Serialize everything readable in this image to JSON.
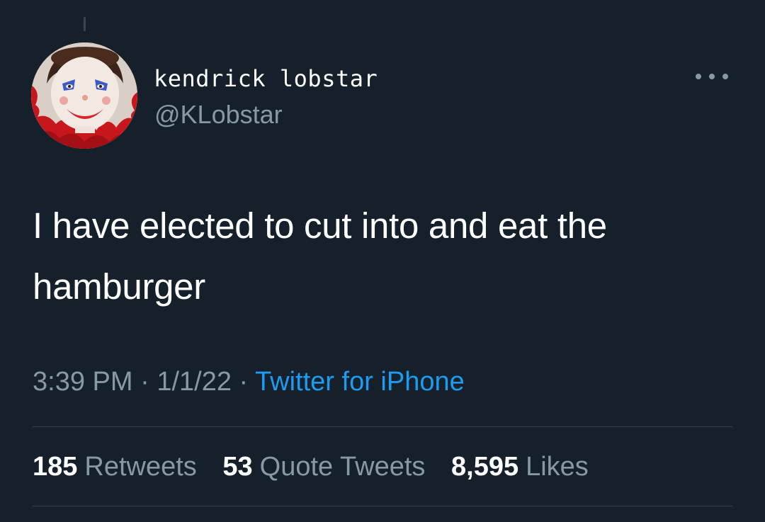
{
  "author": {
    "display_name": "kendrick lobstar",
    "handle": "@KLobstar",
    "avatar_description": "clown-face-portrait"
  },
  "tweet": {
    "text": "I have elected to cut into and eat the hamburger",
    "time": "3:39 PM",
    "date": "1/1/22",
    "separator": "·",
    "source": "Twitter for iPhone"
  },
  "stats": {
    "retweets_count": "185",
    "retweets_label": "Retweets",
    "quote_tweets_count": "53",
    "quote_tweets_label": "Quote Tweets",
    "likes_count": "8,595",
    "likes_label": "Likes"
  },
  "icons": {
    "more": "more-horizontal-icon"
  },
  "colors": {
    "background": "#15202b",
    "primary_text": "#ffffff",
    "secondary_text": "#8899a6",
    "link": "#1d9bf0",
    "divider": "#38444d"
  }
}
